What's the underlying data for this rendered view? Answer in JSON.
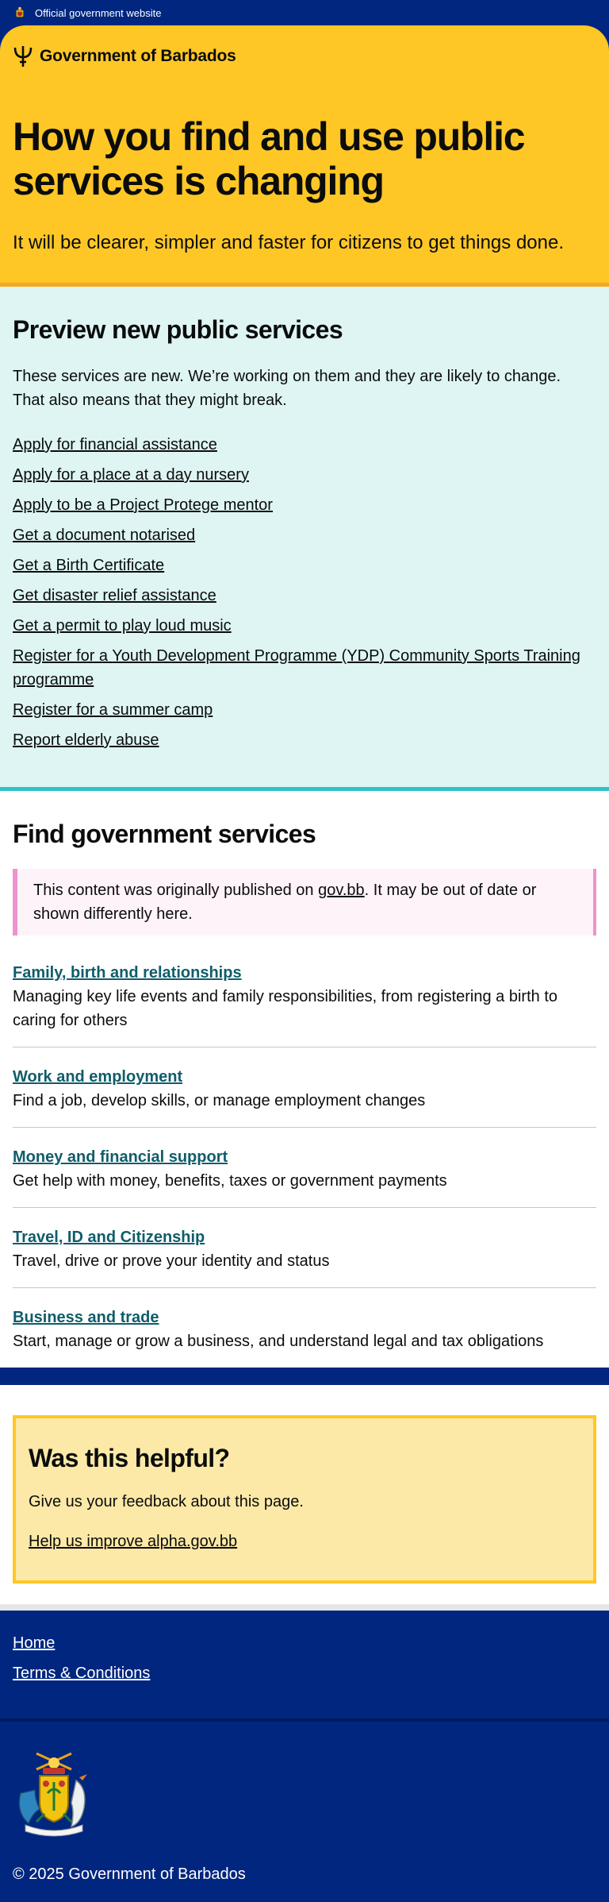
{
  "topbar": {
    "label": "Official government website",
    "crest_icon": "barbados-crest-icon"
  },
  "brand": {
    "name": "Government of Barbados",
    "logo_icon": "trident-icon"
  },
  "hero": {
    "title": "How you find and use public services is changing",
    "subtitle": "It will be clearer, simpler and faster for citizens to get things done."
  },
  "preview": {
    "heading": "Preview new public services",
    "intro": "These services are new. We’re working on them and they are likely to change. That also means that they might break.",
    "links": [
      "Apply for financial assistance",
      "Apply for a place at a day nursery",
      "Apply to be a Project Protege mentor",
      "Get a document notarised",
      "Get a Birth Certificate",
      "Get disaster relief assistance",
      "Get a permit to play loud music",
      "Register for a Youth Development Programme (YDP) Community Sports Training programme",
      "Register for a summer camp",
      "Report elderly abuse"
    ]
  },
  "find": {
    "heading": "Find government services",
    "notice_before": "This content was originally published on ",
    "notice_link": "gov.bb",
    "notice_after": ". It may be out of date or shown differently here.",
    "topics": [
      {
        "title": "Family, birth and relationships",
        "description": "Managing key life events and family responsibilities, from registering a birth to caring for others"
      },
      {
        "title": "Work and employment",
        "description": "Find a job, develop skills, or manage employment changes"
      },
      {
        "title": "Money and financial support",
        "description": "Get help with money, benefits, taxes or government payments"
      },
      {
        "title": "Travel, ID and Citizenship",
        "description": "Travel, drive or prove your identity and status"
      },
      {
        "title": "Business and trade",
        "description": "Start, manage or grow a business, and understand legal and tax obligations"
      }
    ]
  },
  "feedback": {
    "heading": "Was this helpful?",
    "text": "Give us your feedback about this page.",
    "link": "Help us improve alpha.gov.bb"
  },
  "footer": {
    "links": [
      "Home",
      "Terms & Conditions"
    ],
    "coat_of_arms_icon": "coat-of-arms-icon",
    "copyright": "© 2025 Government of Barbados"
  },
  "colors": {
    "navy": "#00267f",
    "gold": "#ffc726",
    "teal_bg": "#def5f3",
    "topic_link": "#0f5d6b",
    "notice_border": "#ed93cf"
  }
}
